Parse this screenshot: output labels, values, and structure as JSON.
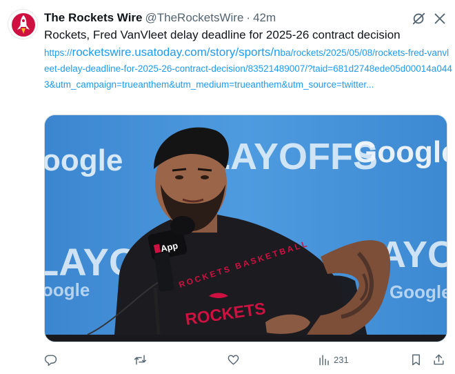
{
  "tweet": {
    "author_name": "The Rockets Wire",
    "author_handle": "@TheRocketsWire",
    "separator": "·",
    "time": "42m",
    "text": "Rockets, Fred VanVleet delay deadline for 2025-26 contract decision",
    "link_prefix": "https://",
    "link_domain": "rocketswire.usatoday.com/story/sports/n",
    "link_rest": "ba/rockets/2025/05/08/rockets-fred-vanvleet-delay-deadline-for-2025-26-contract-decision/83521489007/?taid=681d2748ede05d00014a0443&utm_campaign=trueanthem&utm_medium=trueanthem&utm_source=twitter...",
    "media": {
      "backdrop_words": [
        "oogle",
        "PLAYOFFS",
        "Google",
        "LAYOFFS",
        "LAYOFF",
        "Google",
        "oogle"
      ],
      "mic_brand": "App",
      "shirt_text": "ROCKETS",
      "shirt_arc": "ROCKETS BASKETBALL"
    },
    "stats": {
      "views": "231"
    }
  },
  "icons": {
    "avatar": "rockets-logo-icon",
    "grok": "grok-icon",
    "more": "more-icon",
    "reply": "reply-icon",
    "retweet": "retweet-icon",
    "like": "heart-icon",
    "views": "views-icon",
    "bookmark": "bookmark-icon",
    "share": "share-icon"
  },
  "colors": {
    "link": "#1d9bf0",
    "muted": "#536471",
    "rockets_red": "#ce1141"
  }
}
